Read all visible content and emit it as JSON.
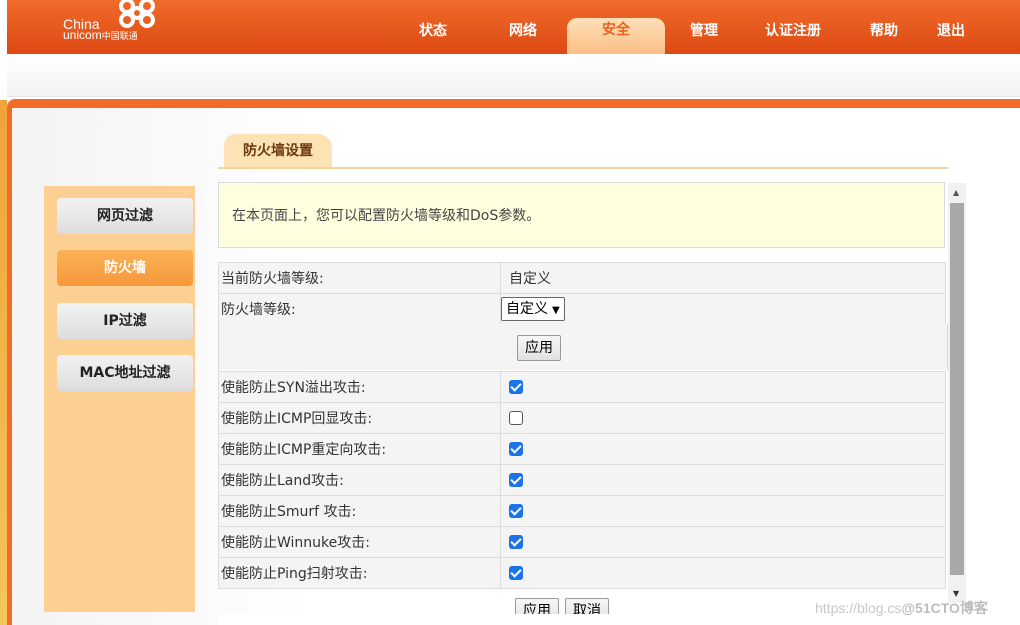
{
  "brand": {
    "line1": "China",
    "line2": "unicom",
    "line2_cn": "中国联通"
  },
  "nav": [
    {
      "label": "状态"
    },
    {
      "label": "网络"
    },
    {
      "label": "安全",
      "active": true
    },
    {
      "label": "管理"
    },
    {
      "label": "认证注册"
    },
    {
      "label": "帮助"
    },
    {
      "label": "退出"
    }
  ],
  "sidebar": {
    "items": [
      {
        "label": "网页过滤"
      },
      {
        "label": "防火墙",
        "active": true
      },
      {
        "label": "IP过滤"
      },
      {
        "label": "MAC地址过滤"
      }
    ]
  },
  "page": {
    "tab_title": "防火墙设置",
    "info_text": "在本页面上，您可以配置防火墙等级和DoS参数。",
    "current_level_label": "当前防火墙等级:",
    "current_level_value": "自定义",
    "level_label": "防火墙等级:",
    "level_select_value": "自定义",
    "apply_label": "应用",
    "cancel_label": "取消",
    "options": [
      {
        "label": "使能防止SYN溢出攻击:",
        "checked": true
      },
      {
        "label": "使能防止ICMP回显攻击:",
        "checked": false
      },
      {
        "label": "使能防止ICMP重定向攻击:",
        "checked": true
      },
      {
        "label": "使能防止Land攻击:",
        "checked": true
      },
      {
        "label": "使能防止Smurf 攻击:",
        "checked": true
      },
      {
        "label": "使能防止Winnuke攻击:",
        "checked": true
      },
      {
        "label": "使能防止Ping扫射攻击:",
        "checked": true
      }
    ]
  },
  "watermark": {
    "url": "https://blog.cs",
    "brand": "@51CTO博客"
  },
  "colors": {
    "brand_orange": "#e9561b",
    "sidebar_bg": "#fbd092",
    "active_orange": "#f6983b",
    "checkbox_blue": "#1a73e8"
  }
}
